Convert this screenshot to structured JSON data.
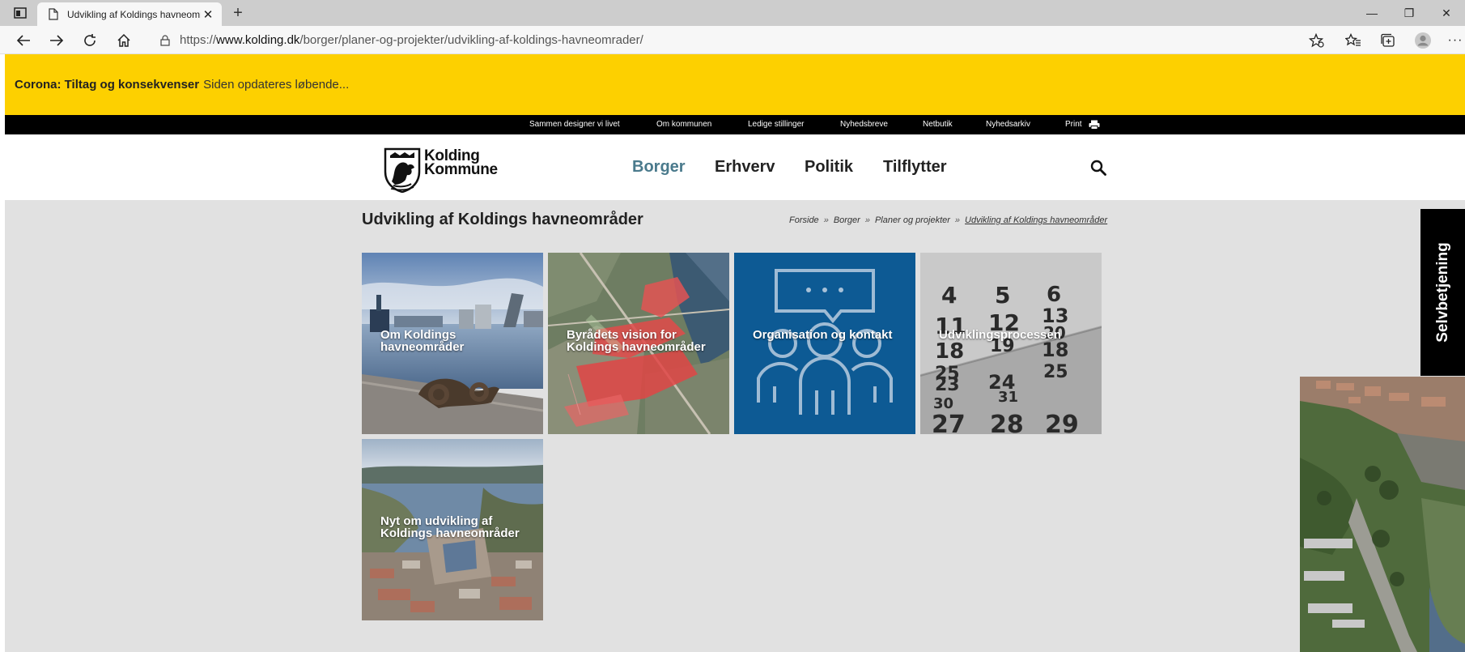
{
  "browser": {
    "tab_title": "Udvikling af Koldings havneområ",
    "url_prefix": "https://",
    "url_host": "www.kolding.dk",
    "url_path": "/borger/planer-og-projekter/udvikling-af-koldings-havneomrader/",
    "icons": [
      "tab-actions-icon",
      "page-icon",
      "close-icon",
      "plus-icon",
      "back-arrow-icon",
      "forward-arrow-icon",
      "refresh-icon",
      "home-icon",
      "lock-icon",
      "favorite-add-icon",
      "favorites-icon",
      "collections-icon",
      "profile-icon",
      "more-icon",
      "minimize-icon",
      "restore-icon"
    ]
  },
  "corona": {
    "strong": "Corona: Tiltag og konsekvenser",
    "text": "Siden opdateres løbende..."
  },
  "topbar": {
    "links": [
      "Sammen designer vi livet",
      "Om kommunen",
      "Ledige stillinger",
      "Nyhedsbreve",
      "Netbutik",
      "Nyhedsarkiv"
    ],
    "print": "Print"
  },
  "header": {
    "logo_line1": "Kolding",
    "logo_line2": "Kommune",
    "nav": [
      "Borger",
      "Erhverv",
      "Politik",
      "Tilflytter"
    ],
    "active_nav_color": "#4a7a8c"
  },
  "page": {
    "title": "Udvikling af Koldings havneområder",
    "breadcrumb": [
      "Forside",
      "Borger",
      "Planer og projekter",
      "Udvikling af Koldings havneområder"
    ],
    "tiles": [
      {
        "label": "Om Koldings havneområder"
      },
      {
        "label": "Byrådets vision for Koldings havneområder"
      },
      {
        "label": "Organisation og kontakt"
      },
      {
        "label": "Udviklingsprocessen"
      },
      {
        "label": "Nyt om udvikling af Koldings havneområder"
      }
    ],
    "calendar_numbers": [
      "4",
      "5",
      "6",
      "11",
      "12",
      "13",
      "18",
      "19",
      "20",
      "18",
      "25",
      "24",
      "25",
      "23",
      "31",
      "30",
      "27",
      "28",
      "29"
    ],
    "side_tab": "Selvbetjening"
  },
  "colors": {
    "corona_banner": "#fdd000",
    "page_bg": "#e1e1e1",
    "org_tile": "#0d5a94"
  }
}
